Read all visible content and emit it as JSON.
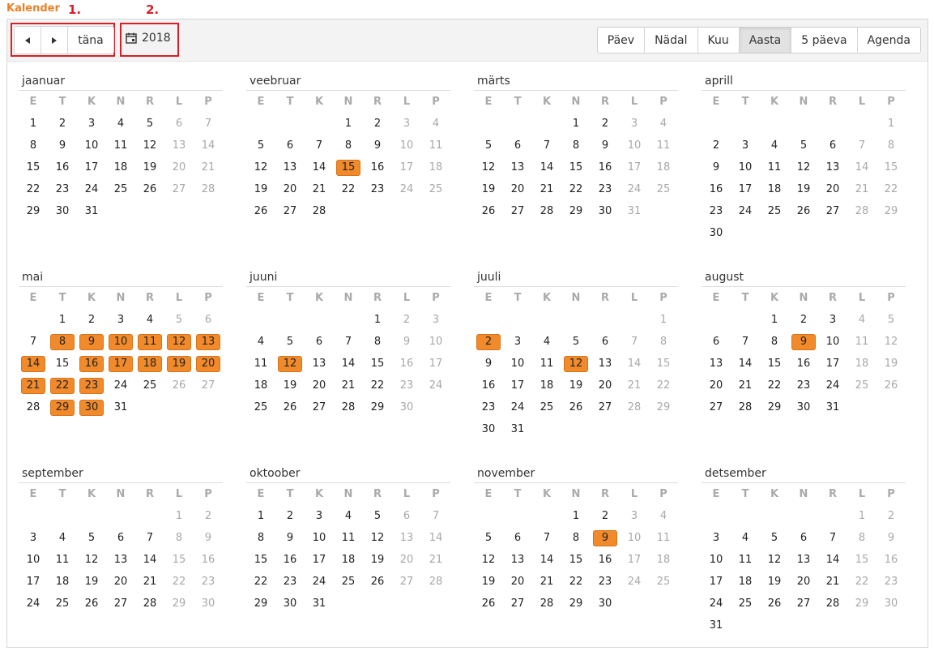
{
  "app_title": "Kalender",
  "annotations": [
    "1.",
    "2."
  ],
  "toolbar": {
    "prev_icon": "triangle-left-icon",
    "next_icon": "triangle-right-icon",
    "today_label": "täna",
    "calendar_icon": "calendar-icon",
    "year": "2018",
    "views": [
      "Päev",
      "Nädal",
      "Kuu",
      "Aasta",
      "5 päeva",
      "Agenda"
    ],
    "active_view": "Aasta"
  },
  "calendar": {
    "weekday_headers": [
      "E",
      "T",
      "K",
      "N",
      "R",
      "L",
      "P"
    ],
    "months": [
      {
        "name": "jaanuar",
        "start": 0,
        "days": 31,
        "events": []
      },
      {
        "name": "veebruar",
        "start": 3,
        "days": 28,
        "events": [
          15
        ]
      },
      {
        "name": "märts",
        "start": 3,
        "days": 31,
        "events": []
      },
      {
        "name": "aprill",
        "start": 6,
        "days": 30,
        "events": []
      },
      {
        "name": "mai",
        "start": 1,
        "days": 31,
        "events": [
          8,
          9,
          10,
          11,
          12,
          13,
          14,
          16,
          17,
          18,
          19,
          20,
          21,
          22,
          23,
          29,
          30
        ]
      },
      {
        "name": "juuni",
        "start": 4,
        "days": 30,
        "events": [
          12
        ]
      },
      {
        "name": "juuli",
        "start": 6,
        "days": 31,
        "events": [
          2,
          12
        ]
      },
      {
        "name": "august",
        "start": 2,
        "days": 31,
        "events": [
          9
        ]
      },
      {
        "name": "september",
        "start": 5,
        "days": 30,
        "events": []
      },
      {
        "name": "oktoober",
        "start": 0,
        "days": 31,
        "events": []
      },
      {
        "name": "november",
        "start": 3,
        "days": 30,
        "events": [
          9
        ]
      },
      {
        "name": "detsember",
        "start": 5,
        "days": 31,
        "events": []
      }
    ],
    "colors": {
      "event": "#f18a2a",
      "weekend_text": "#a8a8a8",
      "accent": "#e8822a",
      "highlight_box": "#d81f26"
    }
  }
}
